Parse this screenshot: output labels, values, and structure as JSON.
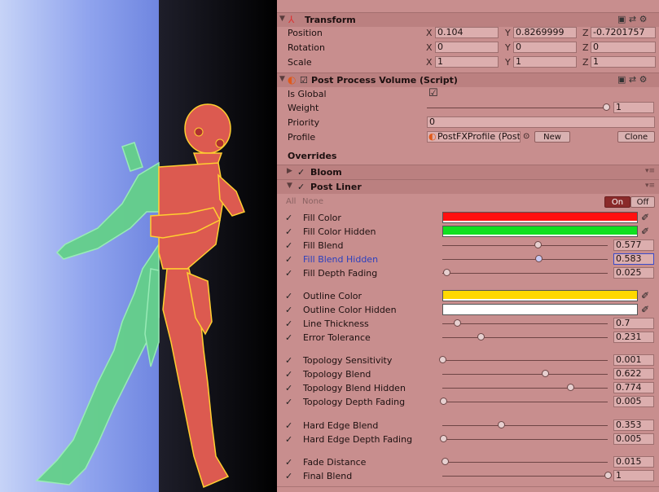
{
  "inspector": {
    "transform": {
      "title": "Transform",
      "rows": [
        {
          "label": "Position",
          "x": "0.104",
          "y": "0.8269999",
          "z": "-0.7201757"
        },
        {
          "label": "Rotation",
          "x": "0",
          "y": "0",
          "z": "0"
        },
        {
          "label": "Scale",
          "x": "1",
          "y": "1",
          "z": "1"
        }
      ],
      "axis_x": "X",
      "axis_y": "Y",
      "axis_z": "Z"
    },
    "ppv": {
      "title": "Post Process Volume (Script)",
      "is_global_label": "Is Global",
      "is_global": true,
      "weight_label": "Weight",
      "weight_value": "1",
      "weight_fraction": 1.0,
      "priority_label": "Priority",
      "priority_value": "0",
      "profile_label": "Profile",
      "profile_value": "PostFXProfile (PostProcessP",
      "new_label": "New",
      "clone_label": "Clone"
    },
    "overrides": {
      "title": "Overrides",
      "bloom_title": "Bloom",
      "liner_title": "Post Liner",
      "all_label": "All",
      "none_label": "None",
      "on_label": "On",
      "off_label": "Off"
    },
    "params": {
      "fill_color": {
        "label": "Fill Color",
        "color": "#ff1010"
      },
      "fill_color_hidden": {
        "label": "Fill Color Hidden",
        "color": "#10e020"
      },
      "fill_blend": {
        "label": "Fill Blend",
        "value": "0.577",
        "fraction": 0.577
      },
      "fill_blend_hidden": {
        "label": "Fill Blend Hidden",
        "value": "0.583",
        "fraction": 0.583
      },
      "fill_depth_fading": {
        "label": "Fill Depth Fading",
        "value": "0.025",
        "fraction": 0.025
      },
      "outline_color": {
        "label": "Outline Color",
        "color": "#ffd800"
      },
      "outline_color_hidden": {
        "label": "Outline Color Hidden",
        "color": "#ffffff"
      },
      "line_thickness": {
        "label": "Line Thickness",
        "value": "0.7",
        "fraction": 0.09
      },
      "error_tolerance": {
        "label": "Error Tolerance",
        "value": "0.231",
        "fraction": 0.231
      },
      "topology_sensitivity": {
        "label": "Topology Sensitivity",
        "value": "0.001",
        "fraction": 0.001
      },
      "topology_blend": {
        "label": "Topology Blend",
        "value": "0.622",
        "fraction": 0.622
      },
      "topology_blend_hidden": {
        "label": "Topology Blend Hidden",
        "value": "0.774",
        "fraction": 0.774
      },
      "topology_depth_fading": {
        "label": "Topology Depth Fading",
        "value": "0.005",
        "fraction": 0.005
      },
      "hard_edge_blend": {
        "label": "Hard Edge Blend",
        "value": "0.353",
        "fraction": 0.353
      },
      "hard_edge_depth_fading": {
        "label": "Hard Edge Depth Fading",
        "value": "0.005",
        "fraction": 0.005
      },
      "fade_distance": {
        "label": "Fade Distance",
        "value": "0.015",
        "fraction": 0.015
      },
      "final_blend": {
        "label": "Final Blend",
        "value": "1",
        "fraction": 1.0
      }
    },
    "icons": {
      "transform": "transform-icon",
      "script": "script-icon",
      "help": "help-icon",
      "preset": "preset-icon",
      "gear": "gear-icon",
      "color_picker": "eyedropper-icon"
    }
  }
}
